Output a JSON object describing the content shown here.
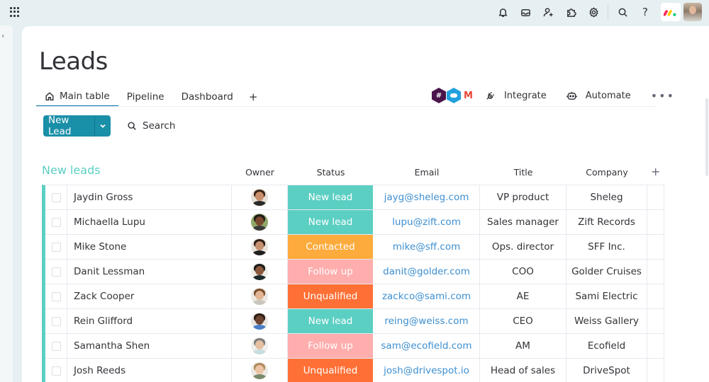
{
  "topbar": {
    "icons": [
      "apps-grid-icon",
      "bell-icon",
      "inbox-icon",
      "invite-user-icon",
      "puzzle-icon",
      "gear-icon",
      "search-icon",
      "help-icon",
      "monday-logo",
      "user-avatar"
    ],
    "help_label": "?"
  },
  "page": {
    "title": "Leads"
  },
  "tabs": [
    {
      "label": "Main table",
      "icon": "home-icon",
      "active": true
    },
    {
      "label": "Pipeline",
      "active": false
    },
    {
      "label": "Dashboard",
      "active": false
    }
  ],
  "tab_add_label": "+",
  "toolbar": {
    "integrations": [
      "slack",
      "salesforce",
      "gmail"
    ],
    "gmail_label": "M",
    "integrate_label": "Integrate",
    "automate_label": "Automate",
    "more_label": "•••"
  },
  "actions": {
    "new_item_label": "New Lead",
    "search_label": "Search"
  },
  "group": {
    "title": "New leads",
    "color": "#5ccfc3",
    "columns": [
      "Owner",
      "Status",
      "Email",
      "Title",
      "Company"
    ],
    "add_column_label": "+",
    "rows": [
      {
        "name": "Jaydin Gross",
        "status": "New lead",
        "email": "jayg@sheleg.com",
        "title": "VP product",
        "company": "Sheleg"
      },
      {
        "name": "Michaella Lupu",
        "status": "New lead",
        "email": "lupu@zift.com",
        "title": "Sales manager",
        "company": "Zift Records"
      },
      {
        "name": "Mike Stone",
        "status": "Contacted",
        "email": "mike@sff.com",
        "title": "Ops. director",
        "company": "SFF Inc."
      },
      {
        "name": "Danit Lessman",
        "status": "Follow up",
        "email": "danit@golder.com",
        "title": "COO",
        "company": "Golder Cruises"
      },
      {
        "name": "Zack Cooper",
        "status": "Unqualified",
        "email": "zackco@sami.com",
        "title": "AE",
        "company": "Sami Electric"
      },
      {
        "name": "Rein Glifford",
        "status": "New lead",
        "email": "reing@weiss.com",
        "title": "CEO",
        "company": "Weiss Gallery"
      },
      {
        "name": "Samantha Shen",
        "status": "Follow up",
        "email": "sam@ecofield.com",
        "title": "AM",
        "company": "Ecofield"
      },
      {
        "name": "Josh Reeds",
        "status": "Unqualified",
        "email": "josh@drivespot.io",
        "title": "Head of sales",
        "company": "DriveSpot"
      }
    ]
  },
  "status_colors": {
    "New lead": "#5ccfc3",
    "Contacted": "#fdab3d",
    "Follow up": "#ffadad",
    "Unqualified": "#ff7036"
  },
  "accent_color": "#1a8fa8",
  "link_color": "#3d8fd1"
}
